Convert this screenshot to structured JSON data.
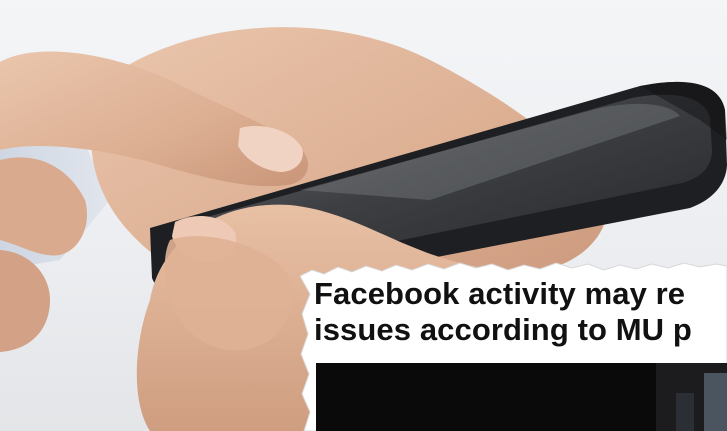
{
  "headline": {
    "line1": "Facebook activity may re",
    "line2": "issues according to MU p"
  },
  "colors": {
    "background": "#eceef1",
    "skin": "#e0b79c",
    "skin_shadow": "#c28d70",
    "phone_body": "#2a2b2e",
    "phone_screen": "#45474b",
    "paper": "#ffffff",
    "headline_text": "#111111"
  }
}
